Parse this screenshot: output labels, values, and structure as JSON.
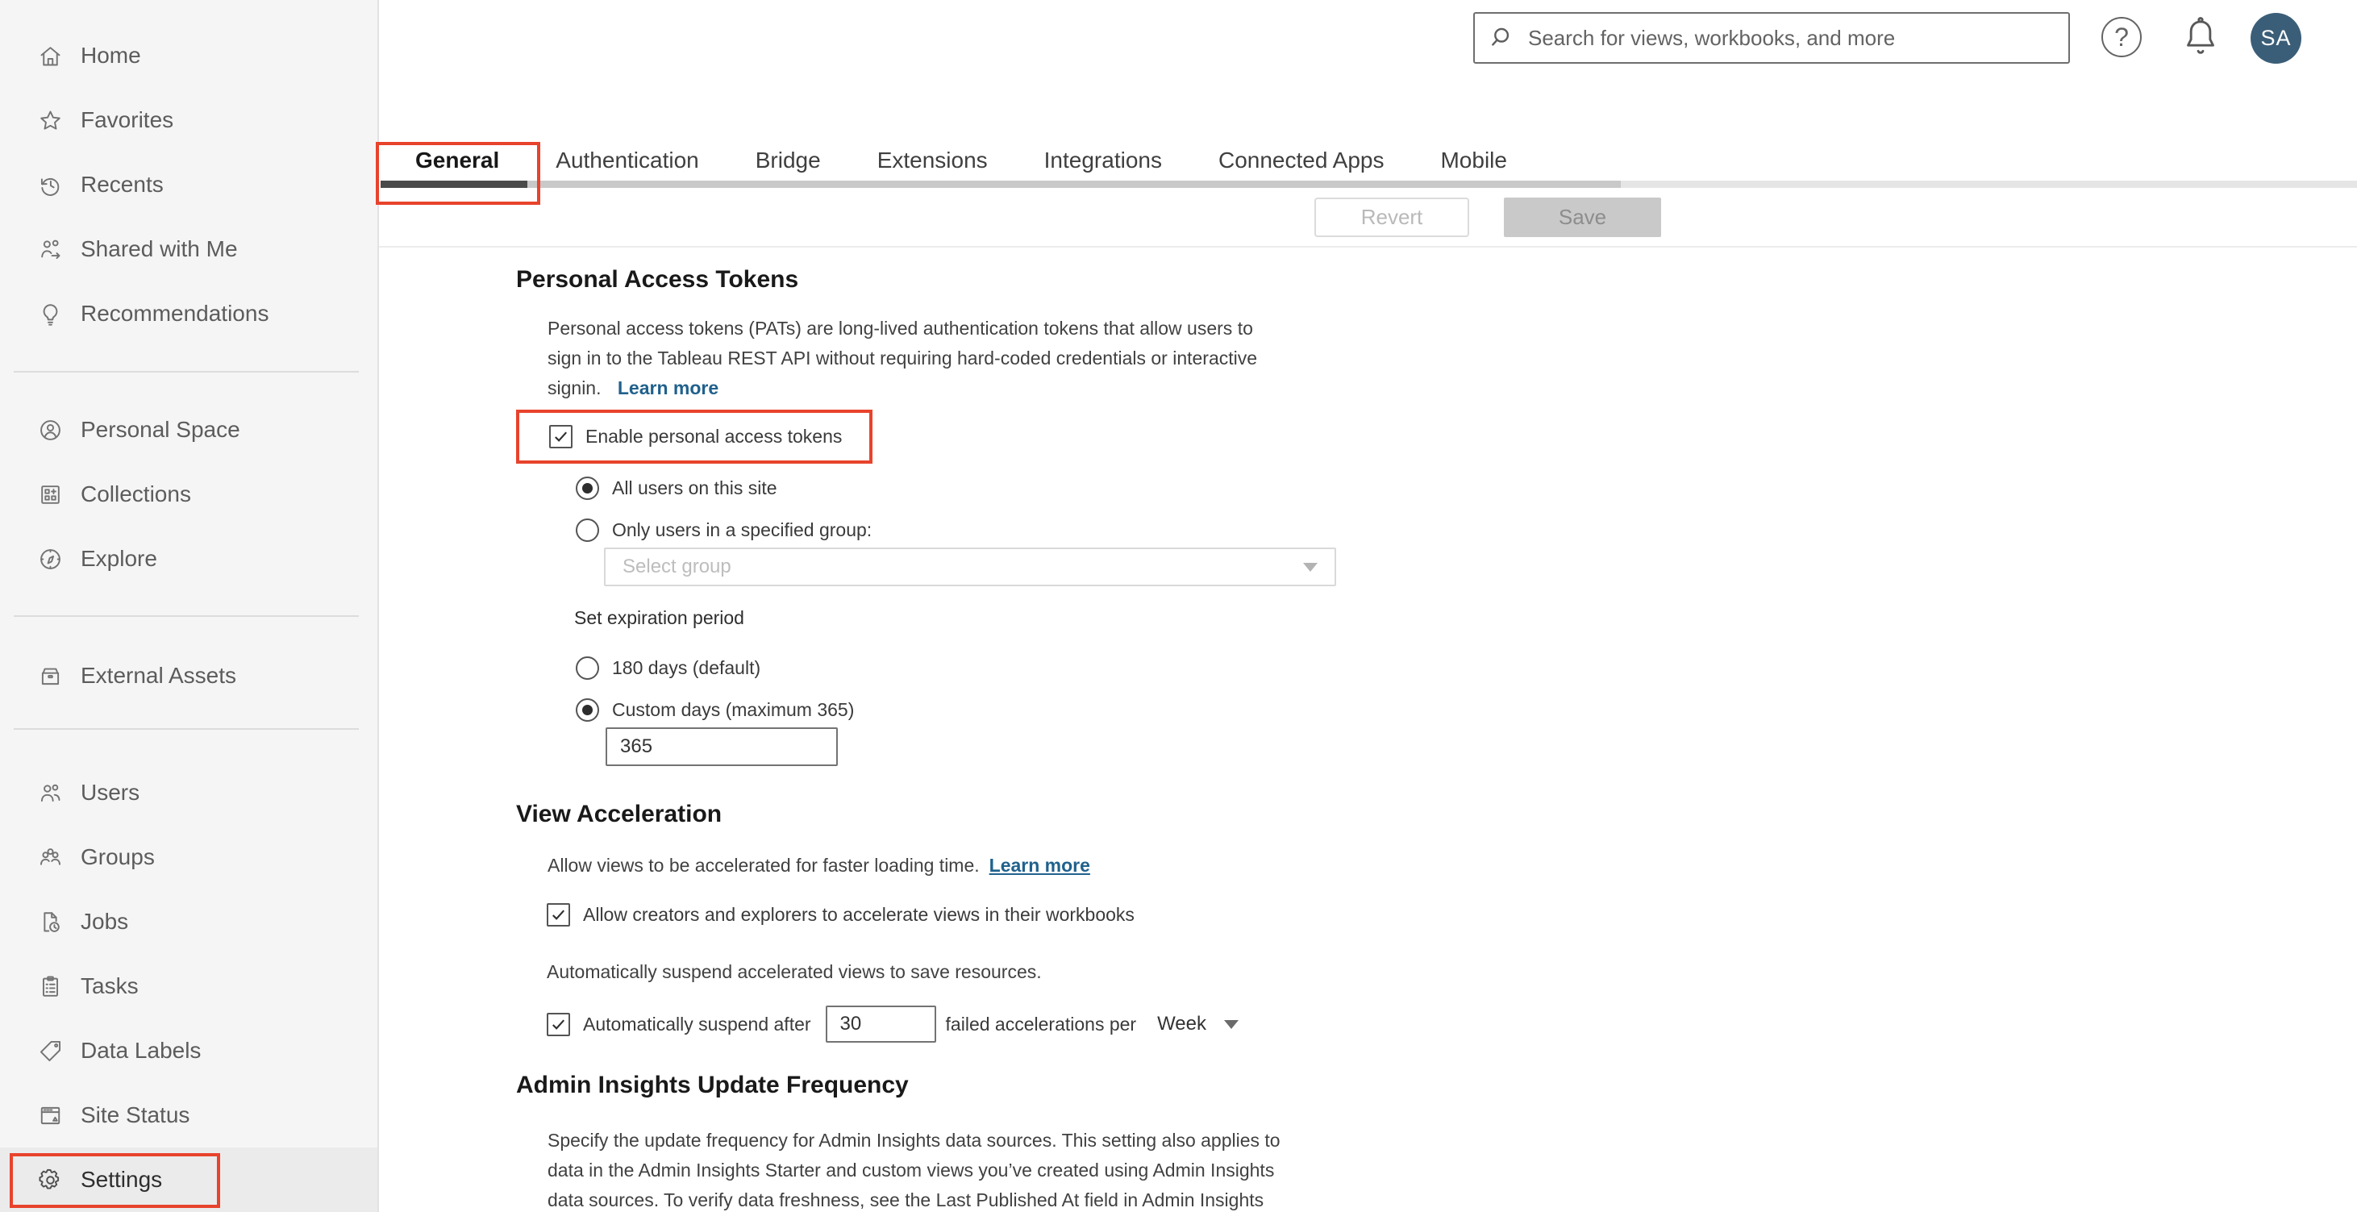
{
  "header": {
    "search_placeholder": "Search for views, workbooks, and more",
    "search_icon": "search-icon",
    "help_glyph": "?",
    "help_icon": "help-icon",
    "bell_icon": "notifications-bell-icon",
    "avatar_initials": "SA",
    "avatar_color": "#3b5e78"
  },
  "sidebar": {
    "items": [
      {
        "label": "Home",
        "icon": "home-icon"
      },
      {
        "label": "Favorites",
        "icon": "star-icon"
      },
      {
        "label": "Recents",
        "icon": "history-icon"
      },
      {
        "label": "Shared with Me",
        "icon": "shared-with-me-icon"
      },
      {
        "label": "Recommendations",
        "icon": "lightbulb-icon"
      },
      {
        "label": "Personal Space",
        "icon": "person-circle-icon"
      },
      {
        "label": "Collections",
        "icon": "collections-grid-icon"
      },
      {
        "label": "Explore",
        "icon": "compass-icon"
      },
      {
        "label": "External Assets",
        "icon": "drawer-icon"
      },
      {
        "label": "Users",
        "icon": "users-icon"
      },
      {
        "label": "Groups",
        "icon": "groups-icon"
      },
      {
        "label": "Jobs",
        "icon": "document-clock-icon"
      },
      {
        "label": "Tasks",
        "icon": "clipboard-icon"
      },
      {
        "label": "Data Labels",
        "icon": "tag-icon"
      },
      {
        "label": "Site Status",
        "icon": "browser-window-icon"
      },
      {
        "label": "Settings",
        "icon": "gear-icon"
      }
    ],
    "active_item": "Settings"
  },
  "tabs": {
    "items": [
      "General",
      "Authentication",
      "Bridge",
      "Extensions",
      "Integrations",
      "Connected Apps",
      "Mobile"
    ],
    "active": "General"
  },
  "toolbar": {
    "revert_label": "Revert",
    "save_label": "Save"
  },
  "sections": {
    "pat": {
      "title": "Personal Access Tokens",
      "desc_lines": [
        "Personal access tokens (PATs) are long-lived authentication tokens that allow users to",
        "sign in to the Tableau REST API without requiring hard-coded credentials or interactive",
        "signin."
      ],
      "learn_more_label": "Learn more",
      "enable_label": "Enable personal access tokens",
      "enable_checked": true,
      "radio_all_users": "All users on this site",
      "radio_only_group": "Only users in a specified group:",
      "selected_scope": "All users on this site",
      "select_placeholder": "Select group",
      "expiration_label": "Set expiration period",
      "radio_180_days": "180 days (default)",
      "radio_custom_days": "Custom days (maximum 365)",
      "selected_expiration": "Custom days (maximum 365)",
      "custom_days_value": "365"
    },
    "va": {
      "title": "View Acceleration",
      "desc": "Allow views to be accelerated for faster loading time.",
      "learn_more_label": "Learn more",
      "allow_label": "Allow creators and explorers to accelerate views in their workbooks",
      "allow_checked": true,
      "suspend_desc": "Automatically suspend accelerated views to save resources.",
      "suspend_prefix": "Automatically suspend after",
      "suspend_value": "30",
      "suspend_suffix": "failed accelerations per",
      "period_value": "Week",
      "suspend_checked": true
    },
    "ai": {
      "title": "Admin Insights Update Frequency",
      "desc_lines": [
        "Specify the update frequency for Admin Insights data sources. This setting also applies to",
        "data in the Admin Insights Starter and custom views you’ve created using Admin Insights",
        "data sources. To verify data freshness, see the Last Published At field in Admin Insights"
      ]
    }
  },
  "colors": {
    "annotation_red": "#e8432c",
    "link_blue": "#20618c",
    "tab_active_underline": "#4a4a4a"
  }
}
